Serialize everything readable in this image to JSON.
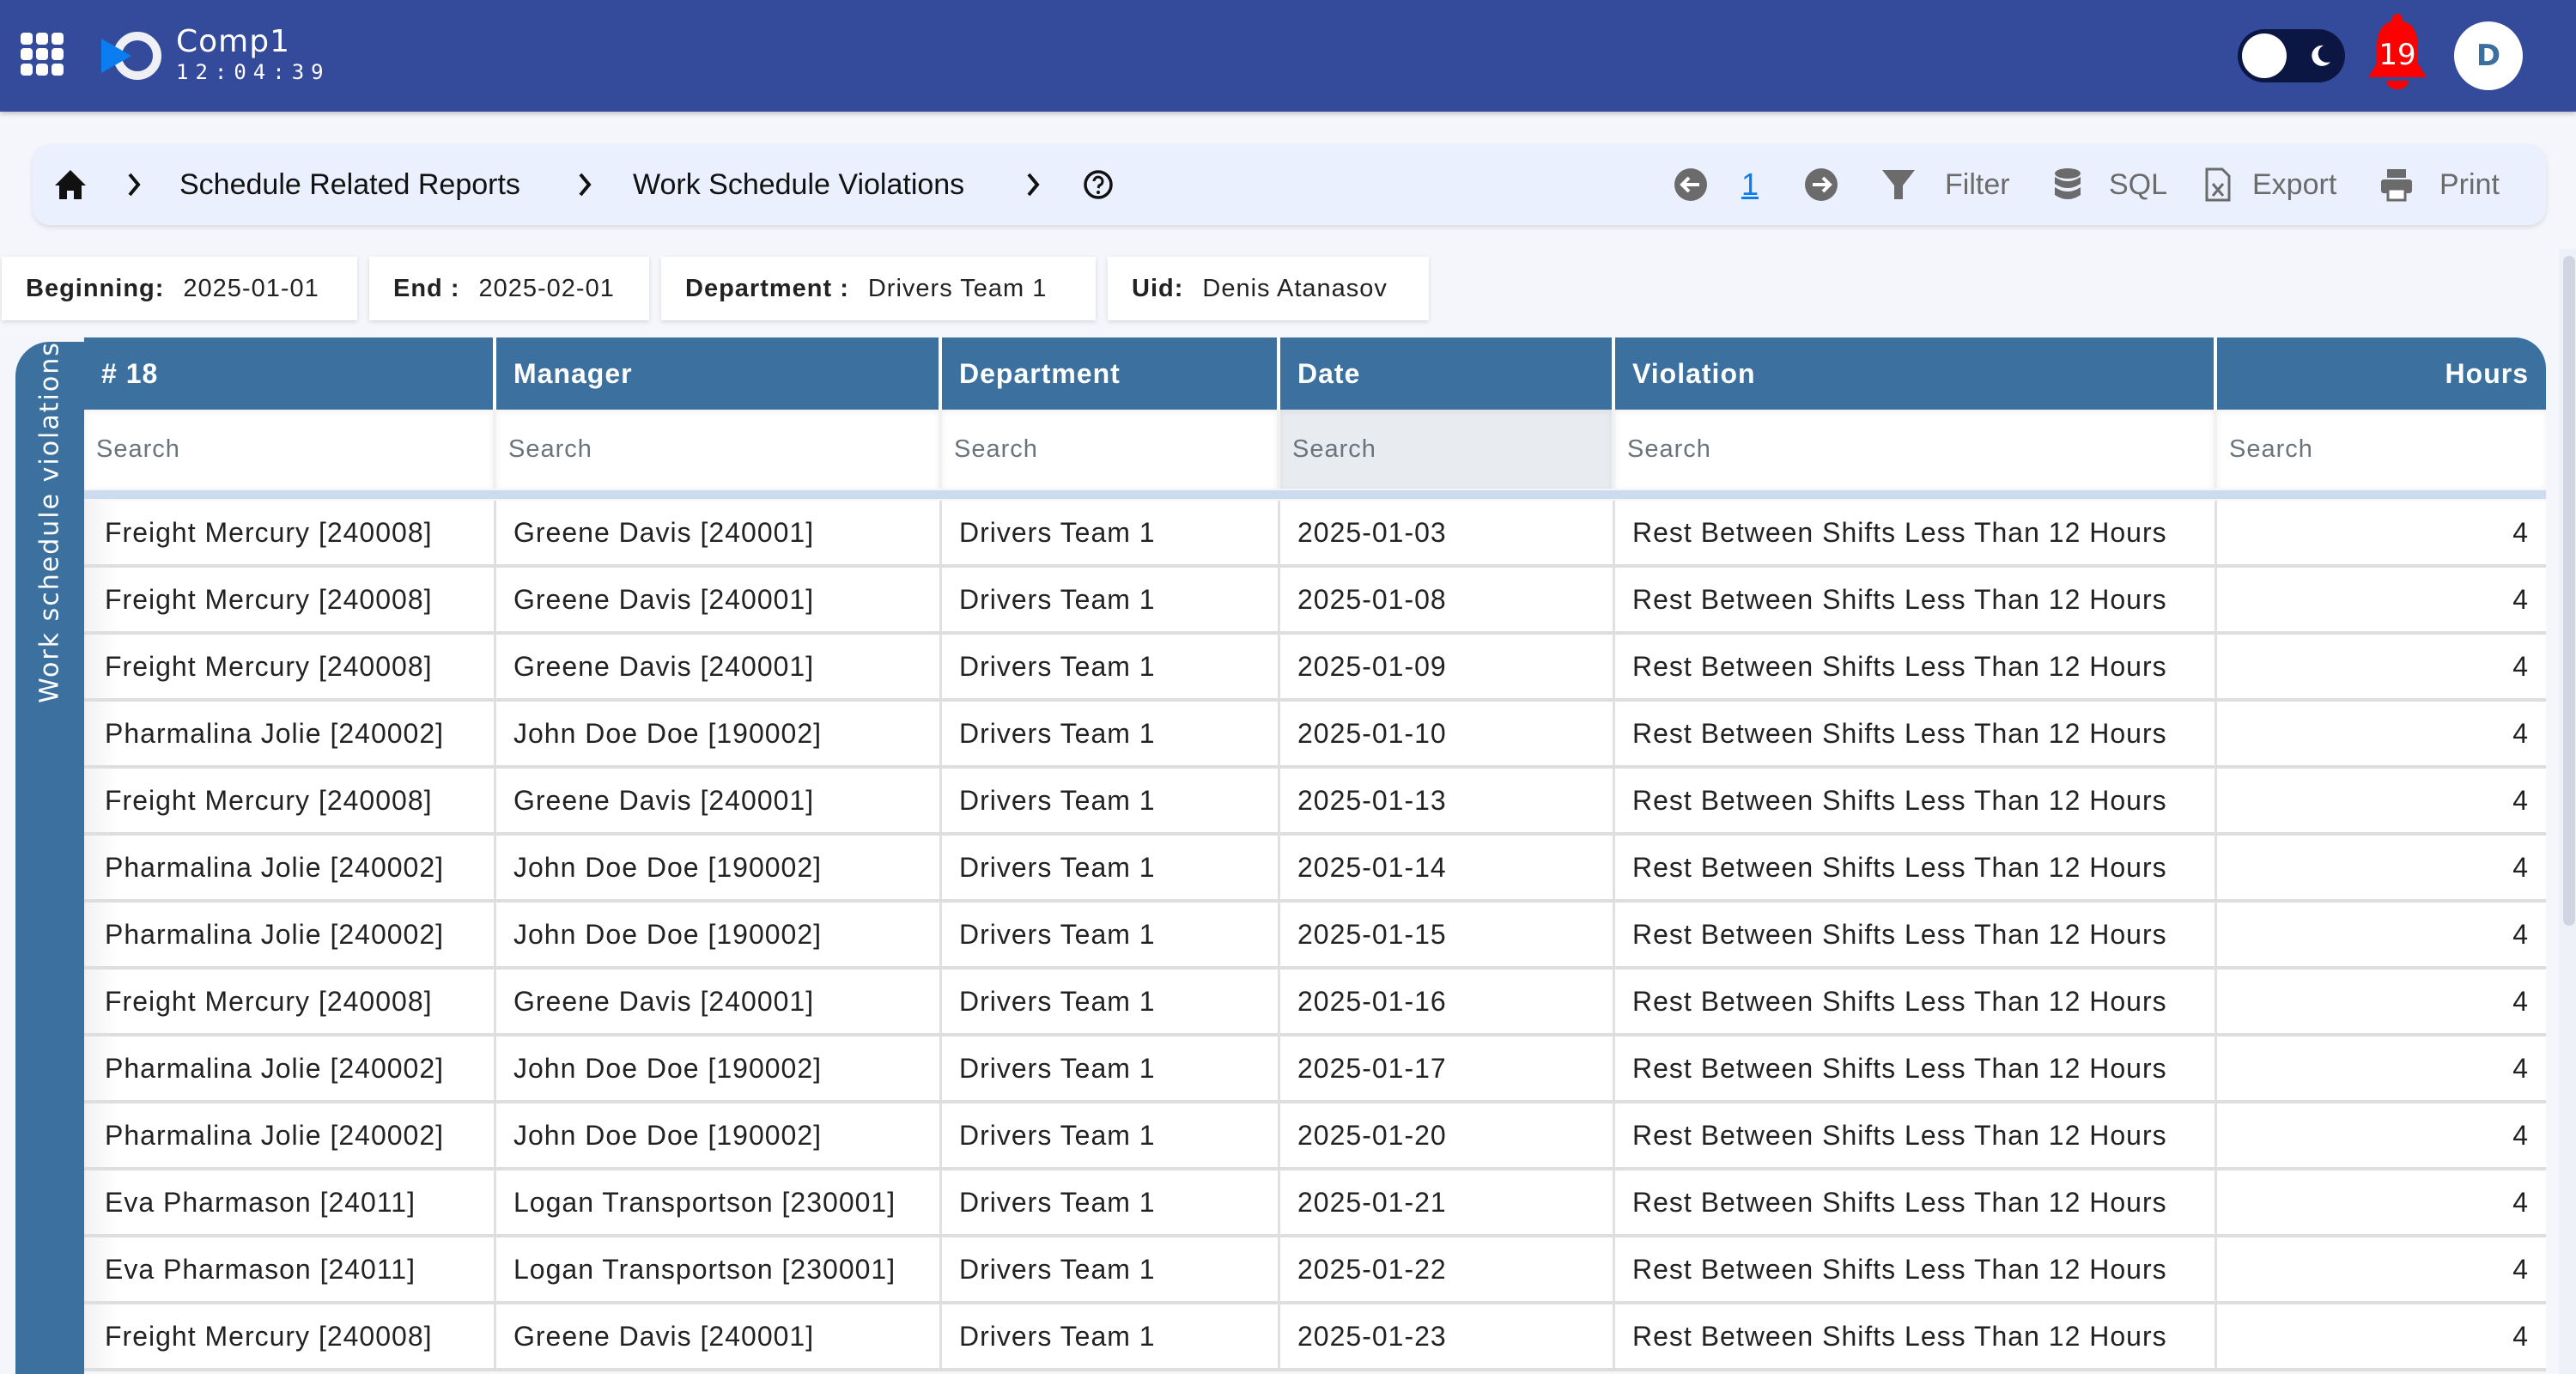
{
  "header": {
    "company": "Comp1",
    "clock": "12:04:39",
    "notifications_count": "19",
    "avatar_initial": "D",
    "icons": {
      "apps": "apps-grid-icon",
      "logo": "company-logo",
      "theme": "dark-mode-toggle",
      "bell": "bell-icon"
    },
    "colors": {
      "bar": "#344a9a",
      "bell": "#ff0000",
      "toggle": "#0b1642",
      "avatar_text": "#3a6fa0"
    }
  },
  "breadcrumb": {
    "items": [
      "Schedule Related Reports",
      "Work Schedule Violations"
    ],
    "home_icon": "home-icon",
    "help_icon": "help-circle-icon"
  },
  "toolbar": {
    "prev_icon": "arrow-left-circle-icon",
    "page": "1",
    "next_icon": "arrow-right-circle-icon",
    "filter_label": "Filter",
    "sql_label": "SQL",
    "export_label": "Export",
    "print_label": "Print"
  },
  "params": [
    {
      "label": "Beginning:",
      "value": "2025-01-01"
    },
    {
      "label": "End :",
      "value": "2025-02-01"
    },
    {
      "label": "Department :",
      "value": "Drivers Team 1"
    },
    {
      "label": "Uid:",
      "value": "Denis Atanasov"
    }
  ],
  "sidetab": {
    "label": "Work schedule violations"
  },
  "table": {
    "columns": [
      "# 18",
      "Manager",
      "Department",
      "Date",
      "Violation",
      "Hours"
    ],
    "search_placeholder": "Search",
    "accent": "#3b709f",
    "rows": [
      [
        "Freight Mercury [240008]",
        "Greene Davis [240001]",
        "Drivers Team 1",
        "2025-01-03",
        "Rest Between Shifts Less Than 12 Hours",
        "4"
      ],
      [
        "Freight Mercury [240008]",
        "Greene Davis [240001]",
        "Drivers Team 1",
        "2025-01-08",
        "Rest Between Shifts Less Than 12 Hours",
        "4"
      ],
      [
        "Freight Mercury [240008]",
        "Greene Davis [240001]",
        "Drivers Team 1",
        "2025-01-09",
        "Rest Between Shifts Less Than 12 Hours",
        "4"
      ],
      [
        "Pharmalina Jolie [240002]",
        "John Doe Doe [190002]",
        "Drivers Team 1",
        "2025-01-10",
        "Rest Between Shifts Less Than 12 Hours",
        "4"
      ],
      [
        "Freight Mercury [240008]",
        "Greene Davis [240001]",
        "Drivers Team 1",
        "2025-01-13",
        "Rest Between Shifts Less Than 12 Hours",
        "4"
      ],
      [
        "Pharmalina Jolie [240002]",
        "John Doe Doe [190002]",
        "Drivers Team 1",
        "2025-01-14",
        "Rest Between Shifts Less Than 12 Hours",
        "4"
      ],
      [
        "Pharmalina Jolie [240002]",
        "John Doe Doe [190002]",
        "Drivers Team 1",
        "2025-01-15",
        "Rest Between Shifts Less Than 12 Hours",
        "4"
      ],
      [
        "Freight Mercury [240008]",
        "Greene Davis [240001]",
        "Drivers Team 1",
        "2025-01-16",
        "Rest Between Shifts Less Than 12 Hours",
        "4"
      ],
      [
        "Pharmalina Jolie [240002]",
        "John Doe Doe [190002]",
        "Drivers Team 1",
        "2025-01-17",
        "Rest Between Shifts Less Than 12 Hours",
        "4"
      ],
      [
        "Pharmalina Jolie [240002]",
        "John Doe Doe [190002]",
        "Drivers Team 1",
        "2025-01-20",
        "Rest Between Shifts Less Than 12 Hours",
        "4"
      ],
      [
        "Eva Pharmason [24011]",
        "Logan Transportson [230001]",
        "Drivers Team 1",
        "2025-01-21",
        "Rest Between Shifts Less Than 12 Hours",
        "4"
      ],
      [
        "Eva Pharmason [24011]",
        "Logan Transportson [230001]",
        "Drivers Team 1",
        "2025-01-22",
        "Rest Between Shifts Less Than 12 Hours",
        "4"
      ],
      [
        "Freight Mercury [240008]",
        "Greene Davis [240001]",
        "Drivers Team 1",
        "2025-01-23",
        "Rest Between Shifts Less Than 12 Hours",
        "4"
      ]
    ]
  }
}
